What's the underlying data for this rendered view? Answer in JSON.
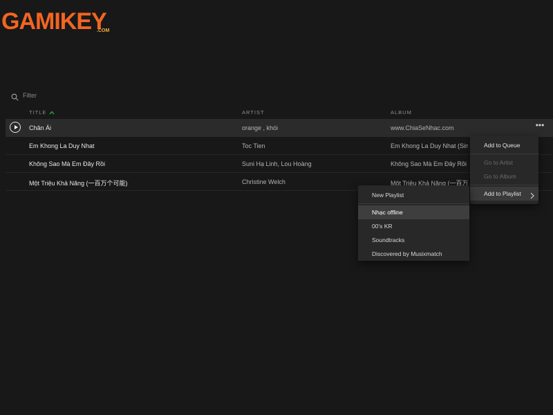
{
  "watermark": {
    "brand": "GAMIKEY",
    "suffix": ".COM",
    "colors": {
      "main": "#f26522",
      "accent": "#fbb040"
    }
  },
  "filter": {
    "placeholder": "Filter",
    "icon": "search-icon"
  },
  "columns": {
    "title": "TITLE",
    "artist": "ARTIST",
    "album": "ALBUM",
    "sort_icon": "chevron-up-icon",
    "sort_color": "#1db954"
  },
  "tracks": [
    {
      "title": "Chân Ái",
      "artist": "orange , khói",
      "album": "www.ChiaSeNhac.com",
      "active": true
    },
    {
      "title": "Em Khong La Duy Nhat",
      "artist": "Toc Tien",
      "album": "Em Khong La Duy Nhat (Sing"
    },
    {
      "title": "Không Sao Mà Em Đây Rồi",
      "artist": "Suni Hạ Linh, Lou Hoàng",
      "album": "Không Sao Mà Em Đây Rồi (S"
    },
    {
      "title": "Một Triệu Khả Năng (一百万个可能)",
      "artist": "Christine Welch",
      "album": "Một Triệu Khả Năng (一百万个"
    }
  ],
  "row_actions": {
    "play_icon": "play-icon",
    "more_icon": "more-horizontal-icon"
  },
  "context_menu": {
    "add_to_queue": "Add to Queue",
    "go_to_artist": "Go to Artist",
    "go_to_album": "Go to Album",
    "add_to_playlist": "Add to Playlist",
    "submenu_icon": "chevron-right-icon"
  },
  "playlist_menu": {
    "new_playlist": "New Playlist",
    "playlists": [
      "Nhạc offline",
      "00's KR",
      "Soundtracks",
      "Discovered by Musixmatch"
    ],
    "hovered_index": 0
  }
}
